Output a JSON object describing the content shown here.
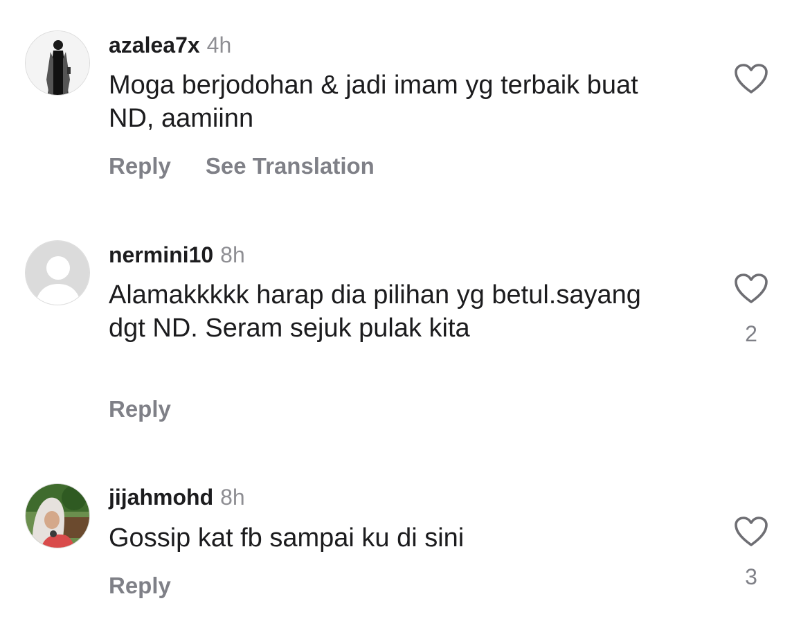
{
  "comments": [
    {
      "username": "azalea7x",
      "time": "4h",
      "text": "Moga berjodohan & jadi imam yg terbaik buat ND, aamiinn",
      "reply_label": "Reply",
      "see_translation_label": "See Translation",
      "avatar_icon": "avatar-photo-woman-black-outfit",
      "like_icon": "heart-outline-icon"
    },
    {
      "username": "nermini10",
      "time": "8h",
      "text": "Alamakkkkk harap dia pilihan yg betul.sayang dgt ND. Seram sejuk pulak kita",
      "reply_label": "Reply",
      "like_count": "2",
      "avatar_icon": "default-avatar-icon",
      "like_icon": "heart-outline-icon"
    },
    {
      "username": "jijahmohd",
      "time": "8h",
      "text": "Gossip kat fb sampai ku di sini",
      "reply_label": "Reply",
      "like_count": "3",
      "avatar_icon": "avatar-photo-hijab-outdoor",
      "like_icon": "heart-outline-icon"
    }
  ],
  "colors": {
    "text": "#1c1c1e",
    "muted": "#8e8e93",
    "action": "#7f8087",
    "icon": "#6e6e73"
  }
}
